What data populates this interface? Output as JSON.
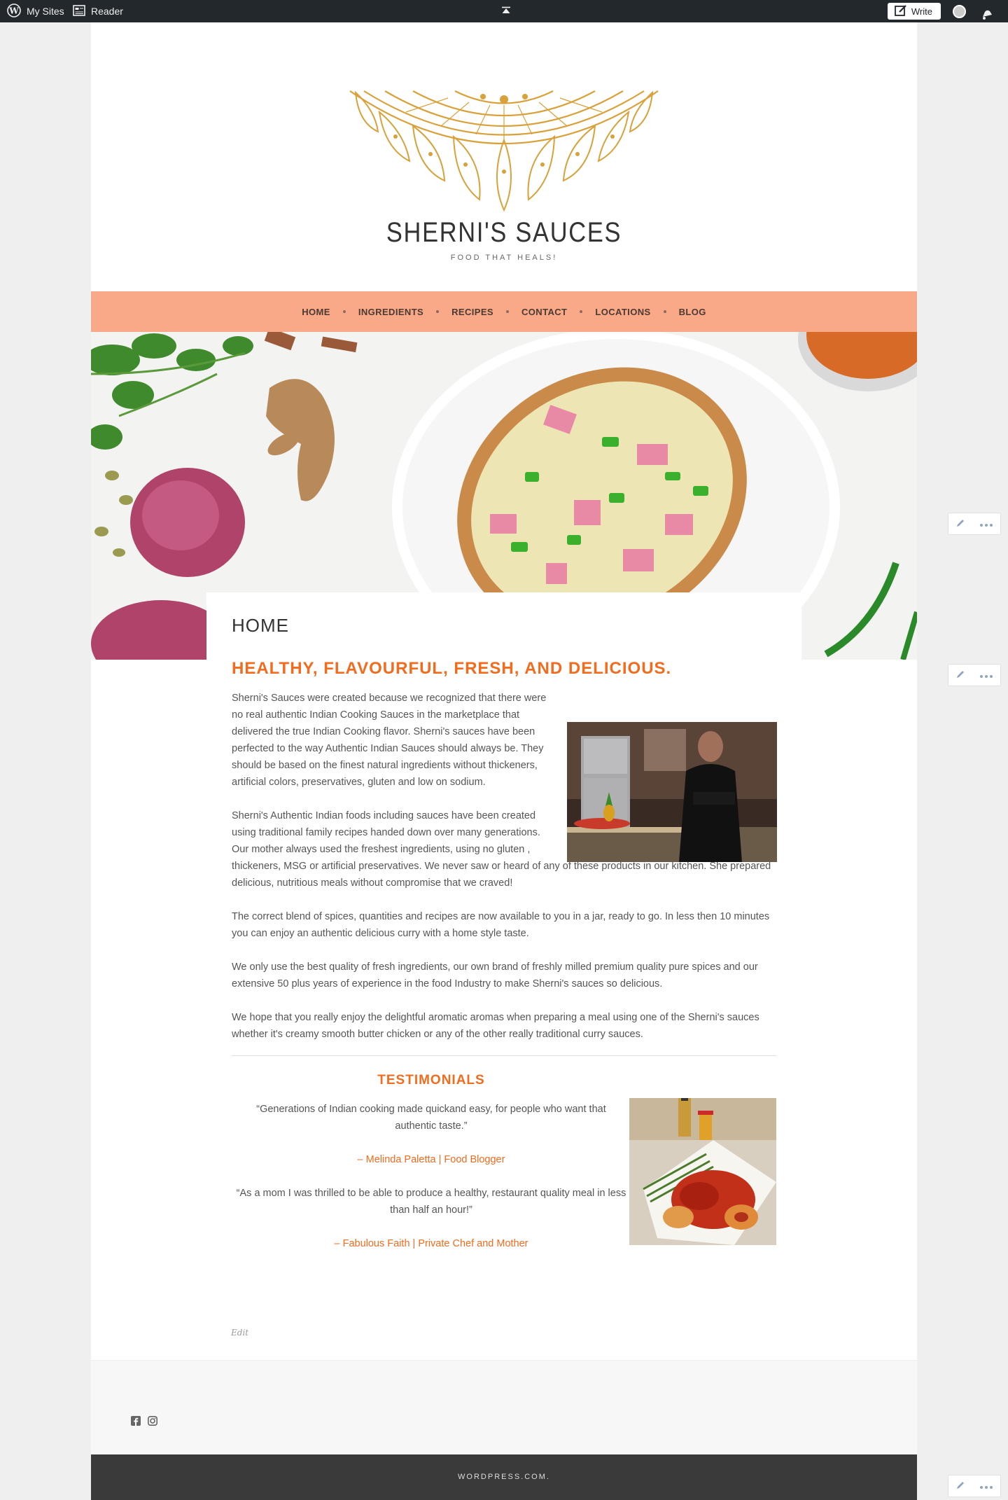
{
  "adminbar": {
    "my_sites": "My Sites",
    "reader": "Reader",
    "write": "Write"
  },
  "site": {
    "title": "SHERNI'S SAUCES",
    "tagline": "FOOD THAT HEALS!"
  },
  "nav": {
    "items": [
      "HOME",
      "INGREDIENTS",
      "RECIPES",
      "CONTACT",
      "LOCATIONS",
      "BLOG"
    ]
  },
  "page": {
    "heading": "HOME",
    "headline": "HEALTHY, FLAVOURFUL, FRESH, AND DELICIOUS.",
    "paragraphs": [
      "Sherni's Sauces were created because we recognized that there were no real authentic Indian Cooking Sauces in the marketplace that delivered the true Indian Cooking flavor. Sherni's sauces have been perfected to the way Authentic Indian Sauces should always be. They should be based on the finest natural ingredients without thickeners, artificial colors, preservatives, gluten and low on sodium.",
      "Sherni's Authentic Indian foods including sauces have been created using traditional family recipes handed down over many generations. Our mother always used the freshest ingredients, using no gluten , thickeners, MSG or artificial preservatives. We never saw or heard of any of these products in our kitchen. She prepared delicious, nutritious meals without compromise that we craved!",
      "The correct blend of spices, quantities and recipes are now available to you in a jar, ready to go. In less then 10 minutes you can enjoy an authentic delicious curry with a home style taste.",
      "We only use the best quality of fresh ingredients, our own brand of freshly milled premium quality pure spices and our extensive 50 plus years of experience in the food Industry to make Sherni's sauces so delicious.",
      "We hope that you really enjoy the delightful aromatic aromas when preparing a meal using one of the Sherni's sauces whether it's creamy smooth butter chicken or any of the other really traditional curry sauces."
    ],
    "edit_label": "Edit"
  },
  "testimonials": {
    "title": "TESTIMONIALS",
    "items": [
      {
        "quote": "“Generations of Indian cooking made quickand easy, for people who want that authentic taste.”",
        "author": "– Melinda Paletta | Food Blogger"
      },
      {
        "quote": "“As a mom I was thrilled to be able to produce a healthy, restaurant quality meal in less than half an hour!”",
        "author": "– Fabulous Faith | Private Chef and Mother"
      }
    ]
  },
  "footer": {
    "credit": "WORDPRESS.COM."
  },
  "colors": {
    "accent": "#f36b1d",
    "nav_bg": "#f9a987",
    "adminbar_bg": "#23282d",
    "footer_bg": "#3a3a3a",
    "logo_gold": "#d9a13a"
  },
  "icons": [
    "wordpress-icon",
    "reader-icon",
    "collapse-icon",
    "write-icon",
    "notifications-icon",
    "pencil-icon",
    "ellipsis-icon",
    "facebook-icon",
    "instagram-icon"
  ]
}
